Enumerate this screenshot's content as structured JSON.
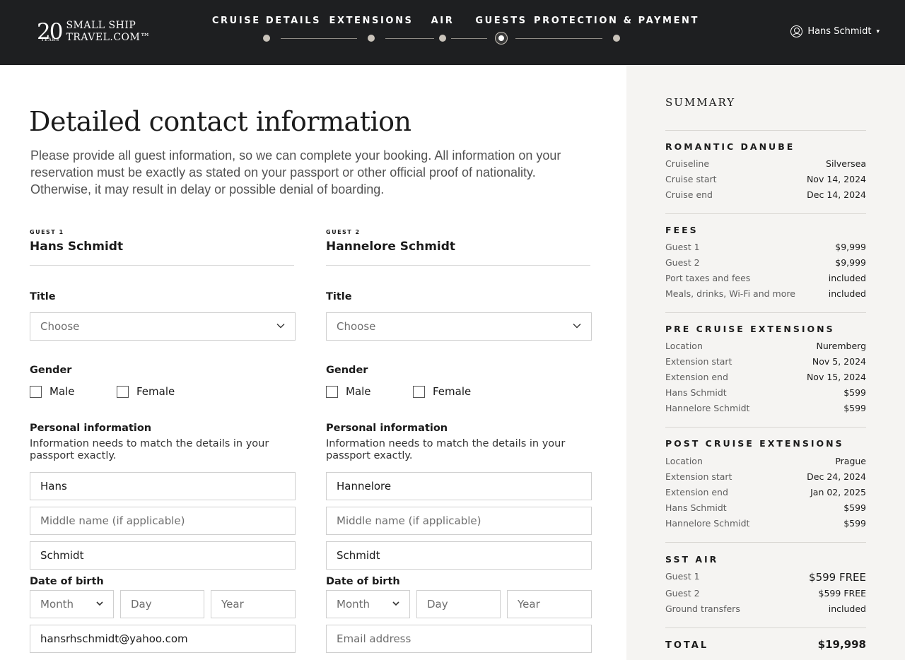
{
  "header": {
    "logo": {
      "number": "20",
      "years": "YEARS",
      "brand_line1": "SMALL SHIP",
      "brand_line2": "TRAVEL.COM™"
    },
    "steps": [
      {
        "label": "CRUISE DETAILS"
      },
      {
        "label": "EXTENSIONS"
      },
      {
        "label": "AIR"
      },
      {
        "label": "GUESTS"
      },
      {
        "label": "PROTECTION & PAYMENT"
      }
    ],
    "active_step": "GUESTS",
    "user": {
      "name": "Hans Schmidt",
      "icon": "user-circle-icon"
    }
  },
  "main": {
    "title": "Detailed contact information",
    "intro": "Please provide all guest information, so we can complete your booking. All information on your reservation must be exactly as stated on your passport or other official proof of nationality. Otherwise, it may result in delay or possible denial of boarding.",
    "labels": {
      "title": "Title",
      "gender": "Gender",
      "male": "Male",
      "female": "Female",
      "personal": "Personal information",
      "personal_sub": "Information needs to match the details in your passport exactly.",
      "dob": "Date of birth"
    },
    "guests": [
      {
        "kicker": "GUEST 1",
        "name": "Hans Schmidt",
        "title_value": "Choose",
        "first_name": "Hans",
        "middle_placeholder": "Middle name (if applicable)",
        "last_name": "Schmidt",
        "month": "Month",
        "day": "Day",
        "year": "Year",
        "email": "hansrhschmidt@yahoo.com"
      },
      {
        "kicker": "GUEST 2",
        "name": "Hannelore Schmidt",
        "title_value": "Choose",
        "first_name": "Hannelore",
        "middle_placeholder": "Middle name (if applicable)",
        "last_name": "Schmidt",
        "month": "Month",
        "day": "Day",
        "year": "Year",
        "email_placeholder": "Email address"
      }
    ]
  },
  "summary": {
    "title": "SUMMARY",
    "cruise": {
      "heading": "ROMANTIC DANUBE",
      "rows": [
        {
          "k": "Cruiseline",
          "v": "Silversea"
        },
        {
          "k": "Cruise start",
          "v": "Nov 14, 2024"
        },
        {
          "k": "Cruise end",
          "v": "Dec 14, 2024"
        }
      ]
    },
    "fees": {
      "heading": "FEES",
      "rows": [
        {
          "k": "Guest 1",
          "v": "$9,999"
        },
        {
          "k": "Guest 2",
          "v": "$9,999"
        },
        {
          "k": "Port taxes and fees",
          "v": "included"
        },
        {
          "k": "Meals, drinks, Wi-Fi and more",
          "v": "included"
        }
      ]
    },
    "pre": {
      "heading": "PRE CRUISE EXTENSIONS",
      "rows": [
        {
          "k": "Location",
          "v": "Nuremberg"
        },
        {
          "k": "Extension start",
          "v": "Nov 5, 2024"
        },
        {
          "k": "Extension end",
          "v": "Nov 15, 2024"
        },
        {
          "k": "Hans Schmidt",
          "v": "$599"
        },
        {
          "k": "Hannelore Schmidt",
          "v": "$599"
        }
      ]
    },
    "post": {
      "heading": "POST CRUISE EXTENSIONS",
      "rows": [
        {
          "k": "Location",
          "v": "Prague"
        },
        {
          "k": "Extension start",
          "v": "Dec 24, 2024"
        },
        {
          "k": "Extension end",
          "v": "Jan 02, 2025"
        },
        {
          "k": "Hans Schmidt",
          "v": "$599"
        },
        {
          "k": "Hannelore Schmidt",
          "v": "$599"
        }
      ]
    },
    "air": {
      "heading": "SST AIR",
      "rows": [
        {
          "k": "Guest 1",
          "v": "$599 FREE"
        },
        {
          "k": "Guest 2",
          "v": "$599 FREE"
        },
        {
          "k": "Ground transfers",
          "v": "included"
        }
      ]
    },
    "total_label": "TOTAL",
    "total_value": "$19,998"
  }
}
